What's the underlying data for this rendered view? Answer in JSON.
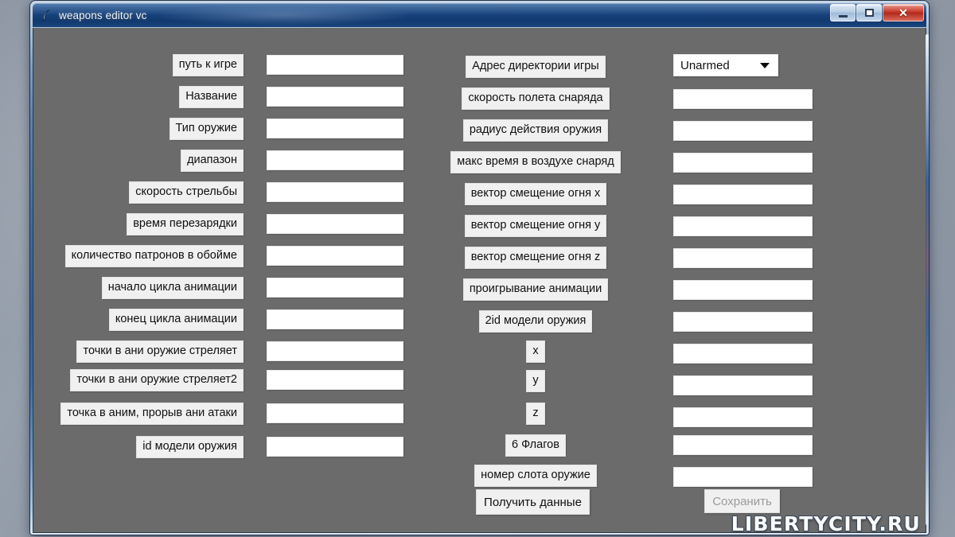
{
  "window": {
    "title": "weapons editor vc",
    "icon": "feather-pen-icon",
    "caption_buttons": {
      "minimize": "minimize-icon",
      "maximize": "maximize-icon",
      "close": "✕"
    }
  },
  "form": {
    "left_column": {
      "labels": [
        "путь к игре",
        "Название",
        "Тип оружие",
        "диапазон",
        "скорость стрельбы",
        "время перезарядки",
        "количество патронов в обойме",
        "начало цикла анимации",
        "конец цикла анимации",
        "точки в ани оружие стреляет",
        "точки в ани оружие стреляет2",
        "точка в аним, прорыв ани атаки",
        "id модели оружия"
      ],
      "values": [
        "",
        "",
        "",
        "",
        "",
        "",
        "",
        "",
        "",
        "",
        "",
        "",
        ""
      ]
    },
    "right_column": {
      "labels": [
        "Адрес директории игры",
        "скорость полета снаряда",
        "радиус действия оружия",
        "макс время в воздухе снаряд",
        "вектор смещение огня x",
        "вектор смещение огня y",
        "вектор смещение огня z",
        "проигрывание анимации",
        "2id модели оружия",
        "x",
        "y",
        "z",
        "6 Флагов",
        "номер слота оружие"
      ],
      "weapon_select": {
        "value": "Unarmed",
        "arrow_icon": "chevron-down-icon"
      },
      "values": [
        "",
        "",
        "",
        "",
        "",
        "",
        "",
        "",
        "",
        "",
        "",
        "",
        ""
      ]
    }
  },
  "actions": {
    "get_data_label": "Получить данные",
    "save_label": "Сохранить",
    "save_enabled": false
  },
  "watermark": "LIBERTYCITY.RU",
  "colors": {
    "client_background": "#6b6b6b",
    "titlebar_blue": "#16407a",
    "close_red": "#b22a1b",
    "label_background": "#f0f0f0",
    "field_background": "#ffffff"
  }
}
